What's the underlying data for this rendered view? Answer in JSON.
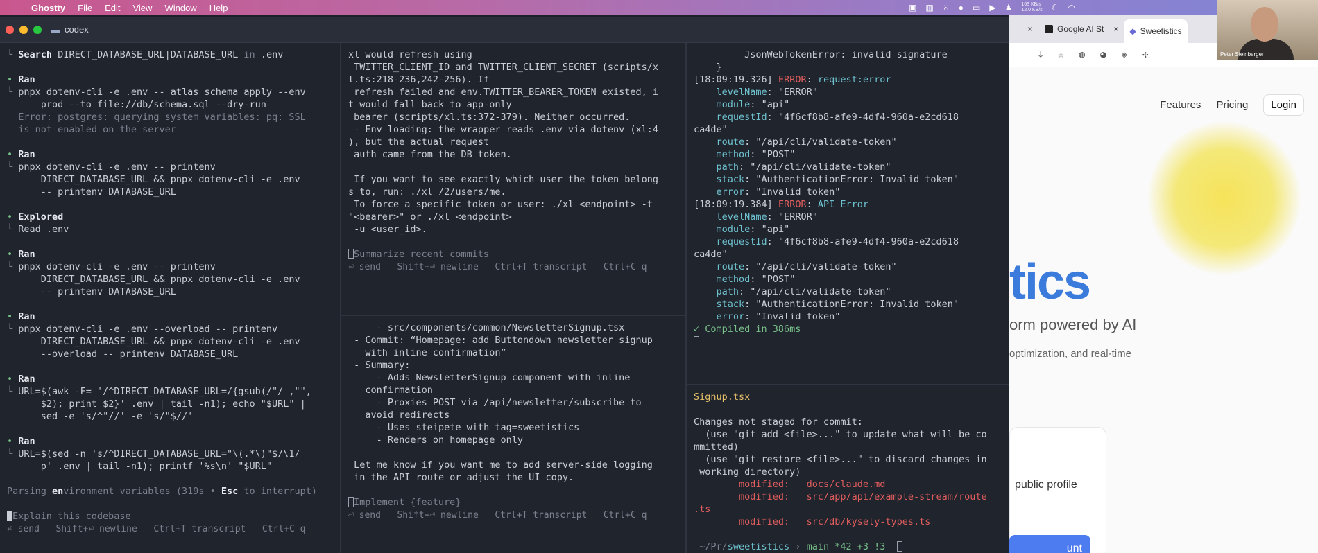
{
  "menubar": {
    "app": "Ghostty",
    "items": [
      "File",
      "Edit",
      "View",
      "Window",
      "Help"
    ],
    "net_up": "163 KB/s",
    "net_down": "12.0 KB/s"
  },
  "window": {
    "title": "codex"
  },
  "pane1": {
    "search_label": "Search",
    "search_query": "DIRECT_DATABASE_URL|DATABASE_URL",
    "search_in": "in",
    "search_file": ".env",
    "blocks": [
      {
        "head": "Ran",
        "lines": [
          "pnpx dotenv-cli -e .env -- atlas schema apply --env",
          "    prod --to file://db/schema.sql --dry-run"
        ],
        "error": [
          "Error: postgres: querying system variables: pq: SSL",
          "is not enabled on the server"
        ]
      },
      {
        "head": "Ran",
        "lines": [
          "pnpx dotenv-cli -e .env -- printenv",
          "    DIRECT_DATABASE_URL && pnpx dotenv-cli -e .env",
          "    -- printenv DATABASE_URL"
        ]
      },
      {
        "head": "Explored",
        "lines": [
          "Read .env"
        ]
      },
      {
        "head": "Ran",
        "lines": [
          "pnpx dotenv-cli -e .env -- printenv",
          "    DIRECT_DATABASE_URL && pnpx dotenv-cli -e .env",
          "    -- printenv DATABASE_URL"
        ]
      },
      {
        "head": "Ran",
        "lines": [
          "pnpx dotenv-cli -e .env --overload -- printenv",
          "    DIRECT_DATABASE_URL && pnpx dotenv-cli -e .env",
          "    --overload -- printenv DATABASE_URL"
        ]
      },
      {
        "head": "Ran",
        "lines": [
          "URL=$(awk -F= '/^DIRECT_DATABASE_URL=/{gsub(/\"/ ,\"\",",
          "    $2); print $2}' .env | tail -n1); echo \"$URL\" |",
          "    sed -e 's/^\"//' -e 's/\"$//'"
        ]
      },
      {
        "head": "Ran",
        "lines": [
          "URL=$(sed -n 's/^DIRECT_DATABASE_URL=\"\\(.*\\)\"$/\\1/",
          "    p' .env | tail -n1); printf '%s\\n' \"$URL\""
        ]
      }
    ],
    "status_pre": "Parsing ",
    "status_bold": "en",
    "status_post": "vironment variables (319s • ",
    "status_esc": "Esc",
    "status_tail": " to interrupt)",
    "input_placeholder": "Explain this codebase",
    "hints": "⏎ send   Shift+⏎ newline   Ctrl+T transcript   Ctrl+C q"
  },
  "pane2": {
    "lines": [
      "xl would refresh using",
      " TWITTER_CLIENT_ID and TWITTER_CLIENT_SECRET (scripts/x",
      "l.ts:218-236,242-256). If",
      " refresh failed and env.TWITTER_BEARER_TOKEN existed, i",
      "t would fall back to app-only",
      " bearer (scripts/xl.ts:372-379). Neither occurred.",
      " - Env loading: the wrapper reads .env via dotenv (xl:4",
      "), but the actual request",
      " auth came from the DB token.",
      "",
      " If you want to see exactly which user the token belong",
      "s to, run: ./xl /2/users/me.",
      " To force a specific token or user: ./xl <endpoint> -t",
      "\"<bearer>\" or ./xl <endpoint>",
      " -u <user_id>."
    ],
    "input_placeholder": "Summarize recent commits",
    "hints": "⏎ send   Shift+⏎ newline   Ctrl+T transcript   Ctrl+C q"
  },
  "pane3": {
    "lines": [
      "     - src/components/common/NewsletterSignup.tsx",
      " - Commit: “Homepage: add Buttondown newsletter signup",
      "   with inline confirmation”",
      " - Summary:",
      "     - Adds NewsletterSignup component with inline",
      "   confirmation",
      "     - Proxies POST via /api/newsletter/subscribe to",
      "   avoid redirects",
      "     - Uses steipete with tag=sweetistics",
      "     - Renders on homepage only",
      "",
      " Let me know if you want me to add server-side logging",
      " in the API route or adjust the UI copy."
    ],
    "input_placeholder": "Implement {feature}",
    "hints": "⏎ send   Shift+⏎ newline   Ctrl+T transcript   Ctrl+C q"
  },
  "pane4": {
    "top_error": "JsonWebTokenError: invalid signature",
    "logs": [
      {
        "time": "[18:09:19.326]",
        "level": "ERROR",
        "msg": "request:error",
        "levelName": "\"ERROR\"",
        "module": "\"api\"",
        "requestId": "\"4f6cf8b8-afe9-4df4-960a-e2cd618",
        "requestIdCont": "ca4de\"",
        "route": "\"/api/cli/validate-token\"",
        "method": "\"POST\"",
        "path": "\"/api/cli/validate-token\"",
        "stack": "\"AuthenticationError: Invalid token\"",
        "error": "\"Invalid token\""
      },
      {
        "time": "[18:09:19.384]",
        "level": "ERROR",
        "msg": "API Error",
        "levelName": "\"ERROR\"",
        "module": "\"api\"",
        "requestId": "\"4f6cf8b8-afe9-4df4-960a-e2cd618",
        "requestIdCont": "ca4de\"",
        "route": "\"/api/cli/validate-token\"",
        "method": "\"POST\"",
        "path": "\"/api/cli/validate-token\"",
        "stack": "\"AuthenticationError: Invalid token\"",
        "error": "\"Invalid token\""
      }
    ],
    "compiled": "✓ Compiled in 386ms"
  },
  "pane5": {
    "filename": "Signup.tsx",
    "lines": [
      "Changes not staged for commit:",
      "  (use \"git add <file>...\" to update what will be co",
      "mmitted)",
      "  (use \"git restore <file>...\" to discard changes in",
      " working directory)"
    ],
    "modified_label": "modified:",
    "modified": [
      "docs/claude.md",
      "src/app/api/example-stream/route",
      ".ts",
      "src/db/kysely-types.ts"
    ],
    "prompt_path": "~/Pr/",
    "prompt_dir": "sweetistics",
    "prompt_branch": "main *42 +3 !3"
  },
  "browser": {
    "tabs": [
      "Google AI St",
      "Sweetistics"
    ],
    "nav": [
      "Features",
      "Pricing",
      "Login"
    ],
    "hero": "tics",
    "subtitle": "orm powered by AI",
    "subtitle2": "optimization, and real-time",
    "card_text": "public profile",
    "cta": "unt"
  },
  "webcam": {
    "name": "Peter Steinberger"
  }
}
